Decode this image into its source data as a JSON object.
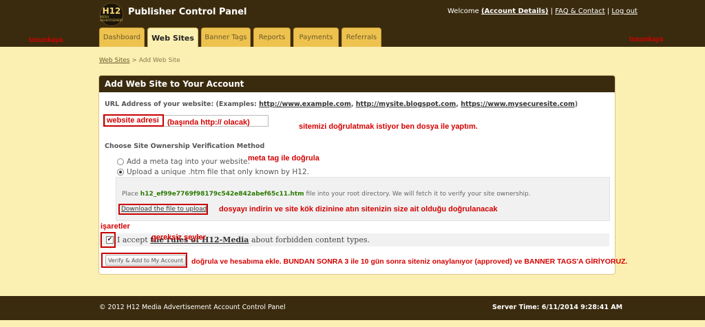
{
  "header": {
    "logo_text": "H12",
    "logo_sub": "MEDIA ADVERTISEMENT",
    "app_title": "Publisher Control Panel",
    "welcome": "Welcome",
    "account_details": "(Account Details)",
    "sep1": "|",
    "faq_contact": "FAQ & Contact",
    "sep2": "|",
    "logout": "Log out"
  },
  "tabs": [
    {
      "label": "Dashboard"
    },
    {
      "label": "Web Sites"
    },
    {
      "label": "Banner Tags"
    },
    {
      "label": "Reports"
    },
    {
      "label": "Payments"
    },
    {
      "label": "Referrals"
    }
  ],
  "breadcrumb": {
    "link": "Web Sites",
    "sep": " > ",
    "current": "Add Web Site"
  },
  "panel": {
    "title": "Add Web Site to Your Account",
    "url_label_prefix": "URL Address of your website: (Examples: ",
    "example1": "http://www.example.com",
    "comma1": ", ",
    "example2": "http://mysite.blogspot.com",
    "comma2": ", ",
    "example3": "https://www.mysecuresite.com",
    "url_label_suffix": ")",
    "choose_label": "Choose Site Ownership Verification Method",
    "option1": "Add a meta tag into your website.",
    "option2": "Upload a unique .htm file that only known by H12.",
    "place_prefix": "Place ",
    "filename": "h12_ef99e7769f98179c542e842abef65c11.htm",
    "place_suffix": " file into your root directory. We will fetch it to verify your site ownership.",
    "download_link": "Download the file to upload.",
    "accept_prefix": "I accept ",
    "accept_link": "the rules of H12-Media",
    "accept_suffix": " about forbidden content types.",
    "checkbox_mark": "✔",
    "verify_button": "Verify & Add to My Account"
  },
  "annotations": {
    "watermark_left": "tosunkaya",
    "watermark_right": "tosunkaya",
    "website_address": "website adresi",
    "http_note": "(başında http:// olacak)",
    "verify_note": "sitemizi doğrulatmak istiyor ben dosya ile yaptım.",
    "meta_note": "meta tag ile doğrula",
    "download_note": "dosyayı indirin ve site kök dizinine atın sitenizin size ait olduğu doğrulanacak",
    "mark_note": "işaretler",
    "rules_note": "gereksiz şeyler",
    "final_note": "doğrula ve hesabıma ekle. BUNDAN SONRA 3 ile 10 gün sonra siteniz onaylanıyor (approved) ve BANNER TAGS'A GİRİYORUZ."
  },
  "footer": {
    "copyright": "© 2012 H12 Media Advertisement Account Control Panel",
    "server_time": "Server Time: 6/11/2014 9:28:41 AM"
  },
  "colors": {
    "header_bg": "#3b2b0e",
    "page_bg": "#fcefb2",
    "tab_bg": "#eec24e",
    "annotation_red": "#d40000"
  }
}
